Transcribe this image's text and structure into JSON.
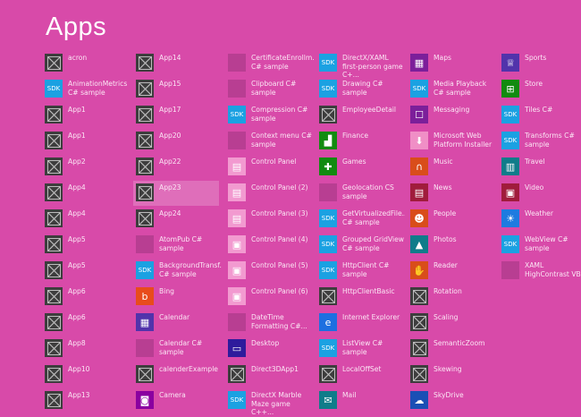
{
  "title": "Apps",
  "columns": [
    [
      {
        "label": "acron",
        "icon": "generic"
      },
      {
        "label": "AnimationMetrics C# sample",
        "icon": "sdk"
      },
      {
        "label": "App1",
        "icon": "generic"
      },
      {
        "label": "App1",
        "icon": "generic"
      },
      {
        "label": "App2",
        "icon": "generic"
      },
      {
        "label": "App4",
        "icon": "generic"
      },
      {
        "label": "App4",
        "icon": "generic"
      },
      {
        "label": "App5",
        "icon": "generic"
      },
      {
        "label": "App5",
        "icon": "generic"
      },
      {
        "label": "App6",
        "icon": "generic"
      },
      {
        "label": "App6",
        "icon": "generic"
      },
      {
        "label": "App8",
        "icon": "generic"
      },
      {
        "label": "App10",
        "icon": "generic"
      },
      {
        "label": "App13",
        "icon": "generic"
      }
    ],
    [
      {
        "label": "App14",
        "icon": "generic"
      },
      {
        "label": "App15",
        "icon": "generic"
      },
      {
        "label": "App17",
        "icon": "generic"
      },
      {
        "label": "App20",
        "icon": "generic"
      },
      {
        "label": "App22",
        "icon": "generic"
      },
      {
        "label": "App23",
        "icon": "generic",
        "selected": true
      },
      {
        "label": "App24",
        "icon": "generic"
      },
      {
        "label": "AtomPub C# sample",
        "icon": "blank"
      },
      {
        "label": "BackgroundTransf... C# sample",
        "icon": "sdk"
      },
      {
        "label": "Bing",
        "icon": "bing",
        "color": "#e84c1c",
        "glyph": "b"
      },
      {
        "label": "Calendar",
        "icon": "calendar",
        "color": "#5133ab",
        "glyph": "▦"
      },
      {
        "label": "Calendar C# sample",
        "icon": "blank"
      },
      {
        "label": "calenderExample",
        "icon": "generic"
      },
      {
        "label": "Camera",
        "icon": "camera",
        "color": "#8a00a0",
        "glyph": "◙"
      }
    ],
    [
      {
        "label": "CertificateEnrollm... C# sample",
        "icon": "blank"
      },
      {
        "label": "Clipboard C# sample",
        "icon": "blank"
      },
      {
        "label": "Compression C# sample",
        "icon": "sdk"
      },
      {
        "label": "Context menu C# sample",
        "icon": "blank"
      },
      {
        "label": "Control Panel",
        "icon": "control-panel",
        "color": "#f29ad0",
        "glyph": "▤"
      },
      {
        "label": "Control Panel (2)",
        "icon": "control-panel",
        "color": "#f29ad0",
        "glyph": "▤"
      },
      {
        "label": "Control Panel (3)",
        "icon": "control-panel",
        "color": "#f29ad0",
        "glyph": "▤"
      },
      {
        "label": "Control Panel (4)",
        "icon": "control-panel",
        "color": "#f29ad0",
        "glyph": "▣"
      },
      {
        "label": "Control Panel (5)",
        "icon": "control-panel",
        "color": "#f29ad0",
        "glyph": "▣"
      },
      {
        "label": "Control Panel (6)",
        "icon": "control-panel",
        "color": "#f29ad0",
        "glyph": "▣"
      },
      {
        "label": "DateTime Formatting C#...",
        "icon": "blank"
      },
      {
        "label": "Desktop",
        "icon": "desktop",
        "color": "#2e1b9c",
        "glyph": "▭"
      },
      {
        "label": "Direct3DApp1",
        "icon": "generic"
      },
      {
        "label": "DirectX Marble Maze game C++...",
        "icon": "sdk"
      }
    ],
    [
      {
        "label": "DirectX/XAML first-person game C+...",
        "icon": "sdk"
      },
      {
        "label": "Drawing C# sample",
        "icon": "sdk"
      },
      {
        "label": "EmployeeDetail",
        "icon": "generic"
      },
      {
        "label": "Finance",
        "icon": "finance",
        "color": "#128b10",
        "glyph": "▟"
      },
      {
        "label": "Games",
        "icon": "games",
        "color": "#118a10",
        "glyph": "✚"
      },
      {
        "label": "Geolocation CS sample",
        "icon": "blank"
      },
      {
        "label": "GetVirtualizedFile... C# sample",
        "icon": "sdk"
      },
      {
        "label": "Grouped GridView C# sample",
        "icon": "sdk"
      },
      {
        "label": "HttpClient C# sample",
        "icon": "sdk"
      },
      {
        "label": "HttpClientBasic",
        "icon": "generic"
      },
      {
        "label": "Internet Explorer",
        "icon": "internet-explorer",
        "color": "#1d6fe0",
        "glyph": "e"
      },
      {
        "label": "ListView C# sample",
        "icon": "sdk"
      },
      {
        "label": "LocalOffSet",
        "icon": "generic"
      },
      {
        "label": "Mail",
        "icon": "mail",
        "color": "#0f7c8a",
        "glyph": "✉"
      }
    ],
    [
      {
        "label": "Maps",
        "icon": "maps",
        "color": "#7c1f9a",
        "glyph": "▦"
      },
      {
        "label": "Media Playback C# sample",
        "icon": "sdk"
      },
      {
        "label": "Messaging",
        "icon": "messaging",
        "color": "#7c1f9a",
        "glyph": "☐"
      },
      {
        "label": "Microsoft Web Platform Installer",
        "icon": "web-platform-installer",
        "color": "#f08fc6",
        "glyph": "⬇"
      },
      {
        "label": "Music",
        "icon": "music",
        "color": "#d94d1a",
        "glyph": "∩"
      },
      {
        "label": "News",
        "icon": "news",
        "color": "#a01c3c",
        "glyph": "▤"
      },
      {
        "label": "People",
        "icon": "people",
        "color": "#d94d1a",
        "glyph": "☻"
      },
      {
        "label": "Photos",
        "icon": "photos",
        "color": "#0f7c8a",
        "glyph": "▲"
      },
      {
        "label": "Reader",
        "icon": "reader",
        "color": "#d94d1a",
        "glyph": "✋"
      },
      {
        "label": "Rotation",
        "icon": "generic"
      },
      {
        "label": "Scaling",
        "icon": "generic"
      },
      {
        "label": "SemanticZoom",
        "icon": "generic"
      },
      {
        "label": "Skewing",
        "icon": "generic"
      },
      {
        "label": "SkyDrive",
        "icon": "skydrive",
        "color": "#1a4fb5",
        "glyph": "☁"
      }
    ],
    [
      {
        "label": "Sports",
        "icon": "sports",
        "color": "#5133ab",
        "glyph": "♕"
      },
      {
        "label": "Store",
        "icon": "store",
        "color": "#128b10",
        "glyph": "⊞"
      },
      {
        "label": "Tiles C#",
        "icon": "sdk"
      },
      {
        "label": "Transforms C# sample",
        "icon": "sdk"
      },
      {
        "label": "Travel",
        "icon": "travel",
        "color": "#0f7c8a",
        "glyph": "▥"
      },
      {
        "label": "Video",
        "icon": "video",
        "color": "#a01c3c",
        "glyph": "▣"
      },
      {
        "label": "Weather",
        "icon": "weather",
        "color": "#1e7be0",
        "glyph": "☀"
      },
      {
        "label": "WebView C# sample",
        "icon": "sdk"
      },
      {
        "label": "XAML HighContrast VB...",
        "icon": "blank"
      }
    ]
  ],
  "sdk_label": "SDK"
}
